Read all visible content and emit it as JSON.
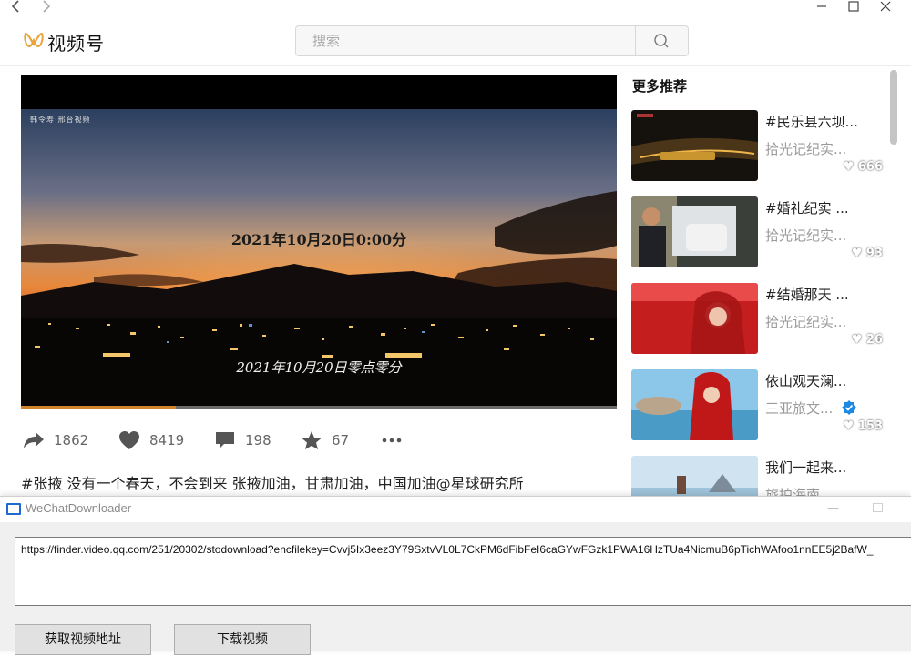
{
  "app": {
    "title": "视频号",
    "search": {
      "placeholder": "搜索",
      "value": ""
    }
  },
  "colors": {
    "accent_logo": "#e9a33b",
    "progress": "#d1842a",
    "verified": "#1e88e5"
  },
  "video": {
    "watermark": "韩令寿·邢台视频",
    "caption_top": "2021年10月20日0:00分",
    "caption_bottom": "2021年10月20日零点零分",
    "progress_fraction": 0.26,
    "actions": {
      "share": {
        "icon": "share-icon",
        "count": "1862"
      },
      "like": {
        "icon": "heart-icon",
        "count": "8419"
      },
      "comment": {
        "icon": "comment-icon",
        "count": "198"
      },
      "favorite": {
        "icon": "star-icon",
        "count": "67"
      },
      "more": {
        "icon": "more-icon"
      }
    },
    "description": "#张掖 没有一个春天，不会到来 张掖加油，甘肃加油，中国加油@星球研究所"
  },
  "recommendations": {
    "title": "更多推荐",
    "items": [
      {
        "title": "#民乐县六坝...",
        "author": "拾光记纪实...",
        "likes": "666",
        "verified": false
      },
      {
        "title": "#婚礼纪实 ...",
        "author": "拾光记纪实...",
        "likes": "93",
        "verified": false
      },
      {
        "title": "#结婚那天 ...",
        "author": "拾光记纪实...",
        "likes": "26",
        "verified": false
      },
      {
        "title": "依山观天澜...",
        "author": "三亚旅文...",
        "likes": "153",
        "verified": true
      },
      {
        "title": "我们一起来...",
        "author": "旅拍海南",
        "likes": "",
        "verified": false
      }
    ]
  },
  "downloader": {
    "title": "WeChatDownloader",
    "url": "https://finder.video.qq.com/251/20302/stodownload?encfilekey=Cvvj5Ix3eez3Y79SxtvVL0L7CkPM6dFibFeI6caGYwFGzk1PWA16HzTUa4NicmuB6pTichWAfoo1nnEE5j2BafW_",
    "buttons": {
      "get_url": "获取视频地址",
      "download": "下载视频"
    }
  }
}
